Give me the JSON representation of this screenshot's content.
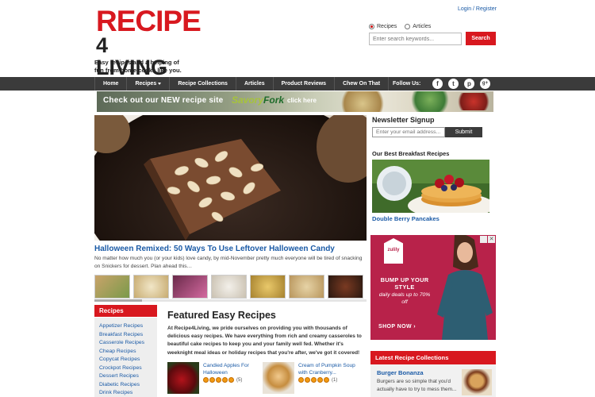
{
  "logo": {
    "line1": "RECIPE",
    "line2": "4 LIVING"
  },
  "tagline": "Easy recipes and a helping of fun from home cooks like you.",
  "header": {
    "login": "Login / Register",
    "radio_recipes": "Recipes",
    "radio_articles": "Articles",
    "search_placeholder": "Enter search keywords...",
    "search_button": "Search"
  },
  "nav": {
    "items": [
      "Home",
      "Recipes",
      "Recipe Collections",
      "Articles",
      "Product Reviews",
      "Chew On That"
    ],
    "follow": "Follow Us:",
    "social": [
      "f",
      "t",
      "p",
      "g+"
    ]
  },
  "banner": {
    "text_check": "Check out our",
    "text_new": "NEW",
    "text_site": "recipe site",
    "brand_a": "Savory",
    "brand_b": "Fork",
    "click": "click here"
  },
  "hero": {
    "title": "Halloween Remixed: 50 Ways To Use Leftover Halloween Candy",
    "desc": "No matter how much you (or your kids) love candy, by mid-November pretty much everyone will be tired of snacking on Snickers for dessert. Plan ahead this…"
  },
  "recipes_sidebar": {
    "title": "Recipes",
    "items": [
      "Appetizer Recipes",
      "Breakfast Recipes",
      "Casserole Recipes",
      "Cheap Recipes",
      "Copycat Recipes",
      "Crockpot Recipes",
      "Dessert Recipes",
      "Diabetic Recipes",
      "Drink Recipes"
    ]
  },
  "featured": {
    "title": "Featured Easy Recipes",
    "text": "At Recipe4Living, we pride ourselves on providing you with thousands of delicious easy recipes. We have everything from rich and creamy casseroles to beautiful cake recipes to keep you and your family well fed. Whether it's weeknight meal ideas or holiday recipes that you're after, we've got it covered!",
    "cards": [
      {
        "name": "Candied Apples For Halloween",
        "count": "(5)"
      },
      {
        "name": "Cream of Pumpkin Soup with Cranberry...",
        "count": "(1)"
      }
    ]
  },
  "newsletter": {
    "title": "Newsletter Signup",
    "placeholder": "Enter your email address...",
    "button": "Submit"
  },
  "breakfast": {
    "title": "Our Best Breakfast Recipes",
    "name": "Double Berry Pancakes"
  },
  "ad": {
    "logo": "zulily",
    "line1": "BUMP UP YOUR STYLE",
    "line2": "daily deals up to 70% off",
    "shop": "SHOP NOW ›",
    "close": "✕"
  },
  "latest": {
    "title": "Latest Recipe Collections",
    "name": "Burger Bonanza",
    "text": "Burgers are so simple that you'd actually have to try to mess them..."
  },
  "colors": {
    "brand_red": "#d8181f",
    "nav_bg": "#3b3b3b",
    "link_blue": "#1a5aa6"
  }
}
